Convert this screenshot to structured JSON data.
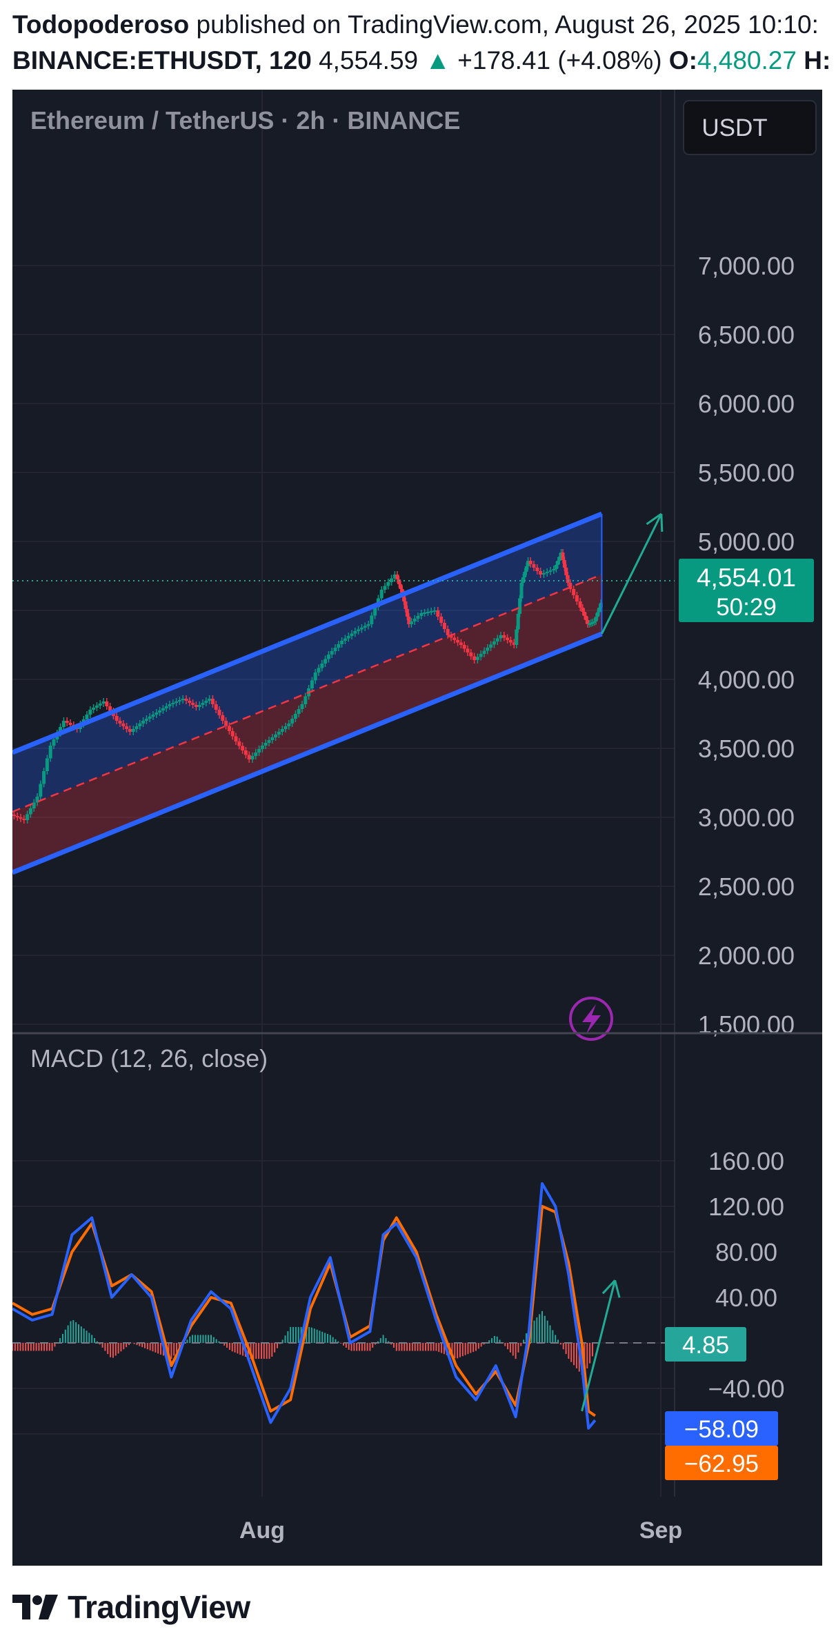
{
  "header": {
    "author": "Todopoderoso",
    "published_text": "published on TradingView.com, August 26, 2025 10:10:",
    "symbol": "BINANCE:ETHUSDT, 120",
    "price": "4,554.59",
    "change_arrow": "▲",
    "change": "+178.41 (+4.08%)",
    "open_label": "O:",
    "open_value": "4,480.27",
    "high_label": "H:"
  },
  "chart_title": "Ethereum / TetherUS · 2h · BINANCE",
  "currency_button": "USDT",
  "last_price_label": "4,554.01",
  "countdown": "50:29",
  "x_axis_labels": [
    "Aug",
    "Sep"
  ],
  "footer_brand": "TradingView",
  "colors": {
    "background": "#171b26",
    "up": "#089981",
    "down": "#f23645",
    "channel_line": "#2962ff",
    "macd_line": "#2962ff",
    "signal_line": "#ff6d00",
    "arrow": "#22ab94"
  },
  "chart_data": [
    {
      "type": "candlestick",
      "title": "Ethereum / TetherUS · 2h · BINANCE",
      "ylim": [
        1500,
        7500
      ],
      "y_ticks": [
        "7,000.00",
        "6,500.00",
        "6,000.00",
        "5,500.00",
        "5,000.00",
        "4,000.00",
        "3,500.00",
        "3,000.00",
        "2,500.00",
        "2,000.00",
        "1,500.00"
      ],
      "y_tick_values": [
        7000,
        6500,
        6000,
        5500,
        5000,
        4000,
        3500,
        3000,
        2500,
        2000,
        1500
      ],
      "last_price": 4554.01,
      "price_path": [
        [
          0,
          3020
        ],
        [
          0.02,
          2980
        ],
        [
          0.04,
          3150
        ],
        [
          0.06,
          3520
        ],
        [
          0.08,
          3700
        ],
        [
          0.1,
          3640
        ],
        [
          0.12,
          3780
        ],
        [
          0.14,
          3840
        ],
        [
          0.16,
          3700
        ],
        [
          0.18,
          3620
        ],
        [
          0.2,
          3700
        ],
        [
          0.22,
          3760
        ],
        [
          0.24,
          3820
        ],
        [
          0.26,
          3860
        ],
        [
          0.28,
          3800
        ],
        [
          0.3,
          3860
        ],
        [
          0.32,
          3700
        ],
        [
          0.34,
          3550
        ],
        [
          0.36,
          3420
        ],
        [
          0.38,
          3520
        ],
        [
          0.4,
          3600
        ],
        [
          0.42,
          3680
        ],
        [
          0.44,
          3820
        ],
        [
          0.46,
          4050
        ],
        [
          0.48,
          4180
        ],
        [
          0.5,
          4280
        ],
        [
          0.52,
          4350
        ],
        [
          0.54,
          4400
        ],
        [
          0.56,
          4650
        ],
        [
          0.58,
          4760
        ],
        [
          0.59,
          4620
        ],
        [
          0.6,
          4400
        ],
        [
          0.62,
          4480
        ],
        [
          0.64,
          4500
        ],
        [
          0.66,
          4320
        ],
        [
          0.68,
          4250
        ],
        [
          0.7,
          4140
        ],
        [
          0.72,
          4230
        ],
        [
          0.74,
          4320
        ],
        [
          0.76,
          4250
        ],
        [
          0.77,
          4700
        ],
        [
          0.78,
          4860
        ],
        [
          0.8,
          4760
        ],
        [
          0.82,
          4800
        ],
        [
          0.83,
          4920
        ],
        [
          0.84,
          4700
        ],
        [
          0.86,
          4520
        ],
        [
          0.87,
          4400
        ],
        [
          0.88,
          4420
        ],
        [
          0.89,
          4554
        ]
      ],
      "channel_upper": [
        [
          0,
          3470
        ],
        [
          0.89,
          5200
        ]
      ],
      "channel_mid": [
        [
          0,
          3040
        ],
        [
          0.89,
          4760
        ]
      ],
      "channel_lower": [
        [
          0,
          2600
        ],
        [
          0.89,
          4330
        ]
      ],
      "projection_arrow": [
        [
          0.89,
          4330
        ],
        [
          0.98,
          5200
        ]
      ]
    },
    {
      "type": "line",
      "title": "MACD (12, 26, close)",
      "ylim": [
        -80,
        160
      ],
      "y_ticks": [
        "160.00",
        "120.00",
        "80.00",
        "40.00",
        "−40.00"
      ],
      "y_tick_values": [
        160,
        120,
        80,
        40,
        -40
      ],
      "series": [
        {
          "name": "MACD",
          "value_label": "−58.09",
          "value": -58.09,
          "x": [
            0,
            0.03,
            0.06,
            0.09,
            0.12,
            0.15,
            0.18,
            0.21,
            0.24,
            0.27,
            0.3,
            0.33,
            0.36,
            0.39,
            0.42,
            0.45,
            0.48,
            0.51,
            0.54,
            0.56,
            0.58,
            0.61,
            0.64,
            0.67,
            0.7,
            0.73,
            0.76,
            0.78,
            0.8,
            0.82,
            0.84,
            0.86,
            0.87,
            0.88
          ],
          "y": [
            30,
            20,
            25,
            95,
            110,
            40,
            60,
            40,
            -30,
            20,
            45,
            30,
            -20,
            -70,
            -40,
            40,
            75,
            0,
            10,
            95,
            105,
            75,
            20,
            -30,
            -50,
            -20,
            -65,
            10,
            140,
            120,
            60,
            -20,
            -75,
            -68
          ]
        },
        {
          "name": "Signal",
          "value_label": "−62.95",
          "value": -62.95,
          "x": [
            0,
            0.03,
            0.06,
            0.09,
            0.12,
            0.15,
            0.18,
            0.21,
            0.24,
            0.27,
            0.3,
            0.33,
            0.36,
            0.39,
            0.42,
            0.45,
            0.48,
            0.51,
            0.54,
            0.56,
            0.58,
            0.61,
            0.64,
            0.67,
            0.7,
            0.73,
            0.76,
            0.78,
            0.8,
            0.82,
            0.84,
            0.86,
            0.87,
            0.88
          ],
          "y": [
            35,
            25,
            30,
            80,
            105,
            50,
            60,
            45,
            -20,
            15,
            40,
            35,
            -10,
            -60,
            -50,
            30,
            70,
            5,
            15,
            90,
            110,
            80,
            25,
            -20,
            -45,
            -25,
            -55,
            0,
            120,
            115,
            70,
            0,
            -60,
            -64
          ]
        },
        {
          "name": "Histogram",
          "value_label": "4.85",
          "value": 4.85
        }
      ],
      "projection_arrow": [
        [
          0.86,
          -60
        ],
        [
          0.91,
          55
        ]
      ]
    }
  ]
}
